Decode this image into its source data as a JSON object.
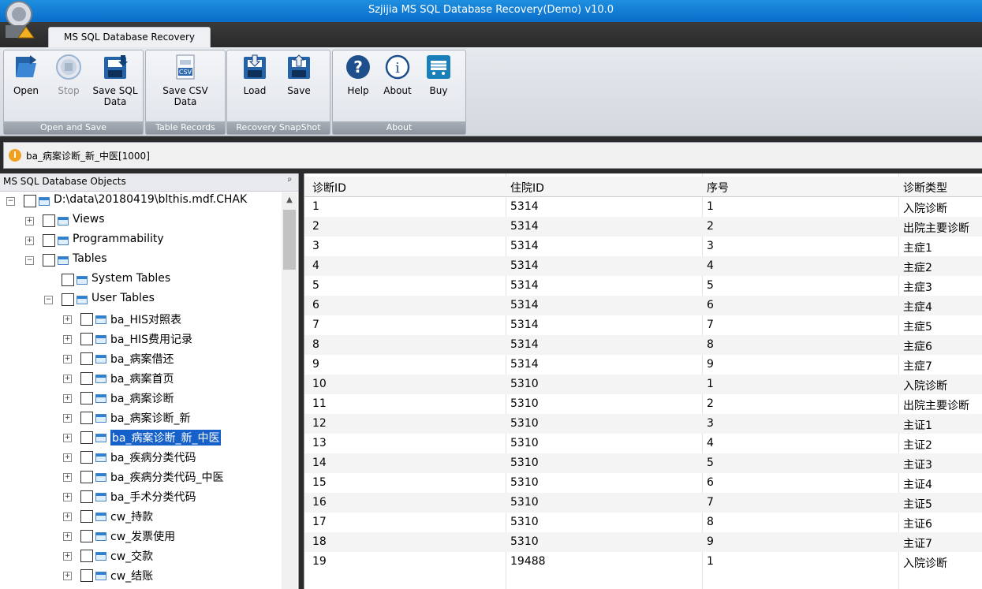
{
  "window": {
    "title": "Szjijia MS SQL Database Recovery(Demo) v10.0"
  },
  "ribbon": {
    "tab_label": "MS SQL Database Recovery",
    "groups": [
      {
        "label": "Open and Save"
      },
      {
        "label": "Table Records"
      },
      {
        "label": "Recovery SnapShot"
      },
      {
        "label": "About"
      }
    ],
    "buttons": {
      "open": "Open",
      "stop": "Stop",
      "save_sql_1": "Save SQL",
      "save_sql_2": "Data",
      "save_csv_1": "Save CSV",
      "save_csv_2": "Data",
      "load": "Load",
      "save": "Save",
      "help": "Help",
      "about": "About",
      "buy": "Buy"
    },
    "icon_text": {
      "csv": "CSV",
      "help": "?",
      "about": "i"
    }
  },
  "infobar": {
    "icon": "i",
    "text": "ba_病案诊断_新_中医[1000]"
  },
  "left_panel": {
    "title": "MS SQL Database Objects",
    "pin": "ᵖ",
    "tree": [
      {
        "label": "D:\\data\\20180419\\blthis.mdf.CHAK",
        "exp": "−"
      },
      {
        "label": "Views",
        "exp": "+"
      },
      {
        "label": "Programmability",
        "exp": "+"
      },
      {
        "label": "Tables",
        "exp": "−"
      },
      {
        "label": "System Tables",
        "exp": ""
      },
      {
        "label": "User Tables",
        "exp": "−"
      },
      {
        "label": "ba_HIS对照表",
        "exp": "+"
      },
      {
        "label": "ba_HIS费用记录",
        "exp": "+"
      },
      {
        "label": "ba_病案借还",
        "exp": "+"
      },
      {
        "label": "ba_病案首页",
        "exp": "+"
      },
      {
        "label": "ba_病案诊断",
        "exp": "+"
      },
      {
        "label": "ba_病案诊断_新",
        "exp": "+"
      },
      {
        "label": "ba_病案诊断_新_中医",
        "exp": "+"
      },
      {
        "label": "ba_疾病分类代码",
        "exp": "+"
      },
      {
        "label": "ba_疾病分类代码_中医",
        "exp": "+"
      },
      {
        "label": "ba_手术分类代码",
        "exp": "+"
      },
      {
        "label": "cw_持款",
        "exp": "+"
      },
      {
        "label": "cw_发票使用",
        "exp": "+"
      },
      {
        "label": "cw_交款",
        "exp": "+"
      },
      {
        "label": "cw_结账",
        "exp": "+"
      }
    ]
  },
  "grid": {
    "columns": [
      "诊断ID",
      "住院ID",
      "序号",
      "诊断类型"
    ],
    "rows": [
      [
        "1",
        "5314",
        "1",
        "入院诊断"
      ],
      [
        "2",
        "5314",
        "2",
        "出院主要诊断"
      ],
      [
        "3",
        "5314",
        "3",
        "主症1"
      ],
      [
        "4",
        "5314",
        "4",
        "主症2"
      ],
      [
        "5",
        "5314",
        "5",
        "主症3"
      ],
      [
        "6",
        "5314",
        "6",
        "主症4"
      ],
      [
        "7",
        "5314",
        "7",
        "主症5"
      ],
      [
        "8",
        "5314",
        "8",
        "主症6"
      ],
      [
        "9",
        "5314",
        "9",
        "主症7"
      ],
      [
        "10",
        "5310",
        "1",
        "入院诊断"
      ],
      [
        "11",
        "5310",
        "2",
        "出院主要诊断"
      ],
      [
        "12",
        "5310",
        "3",
        "主证1"
      ],
      [
        "13",
        "5310",
        "4",
        "主证2"
      ],
      [
        "14",
        "5310",
        "5",
        "主证3"
      ],
      [
        "15",
        "5310",
        "6",
        "主证4"
      ],
      [
        "16",
        "5310",
        "7",
        "主证5"
      ],
      [
        "17",
        "5310",
        "8",
        "主证6"
      ],
      [
        "18",
        "5310",
        "9",
        "主证7"
      ],
      [
        "19",
        "19488",
        "1",
        "入院诊断"
      ]
    ]
  },
  "colors": {
    "titlebar": "#0a6cc8",
    "selection": "#1560c9",
    "disabled_text": "#8a8a8a"
  }
}
